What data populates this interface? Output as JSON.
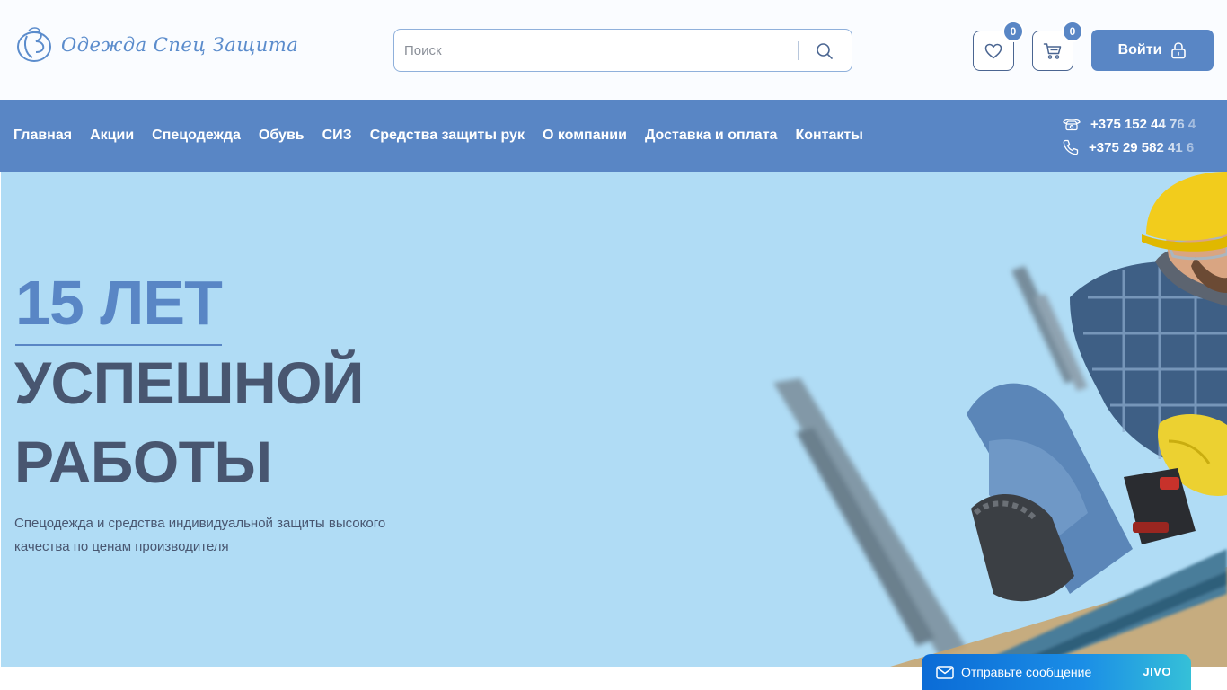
{
  "header": {
    "logo_text": "Одежда Спец Защита",
    "search_placeholder": "Поиск",
    "favorites_count": "0",
    "cart_count": "0",
    "login_label": "Войти"
  },
  "nav": {
    "items": [
      {
        "label": "Главная"
      },
      {
        "label": "Акции"
      },
      {
        "label": "Спецодежда"
      },
      {
        "label": "Обувь"
      },
      {
        "label": "СИЗ"
      },
      {
        "label": "Средства защиты рук"
      },
      {
        "label": "О компании"
      },
      {
        "label": "Доставка и оплата"
      },
      {
        "label": "Контакты"
      }
    ],
    "phones": [
      {
        "icon": "telephone-icon",
        "number": "+375 152 44 76 4"
      },
      {
        "icon": "mobile-phone-icon",
        "number": "+375 29 582 41 6"
      }
    ]
  },
  "hero": {
    "title_line1": "15 ЛЕТ",
    "title_line2": "УСПЕШНОЙ",
    "title_line3": "РАБОТЫ",
    "description": "Спецодежда и средства индивидуальной защиты высокого качества по ценам производителя"
  },
  "chat": {
    "label": "Отправьте сообщение",
    "brand": "JIVO"
  },
  "colors": {
    "brand_blue": "#5986c5",
    "hero_bg": "#b0dcf5",
    "heading_dark": "#485670"
  }
}
